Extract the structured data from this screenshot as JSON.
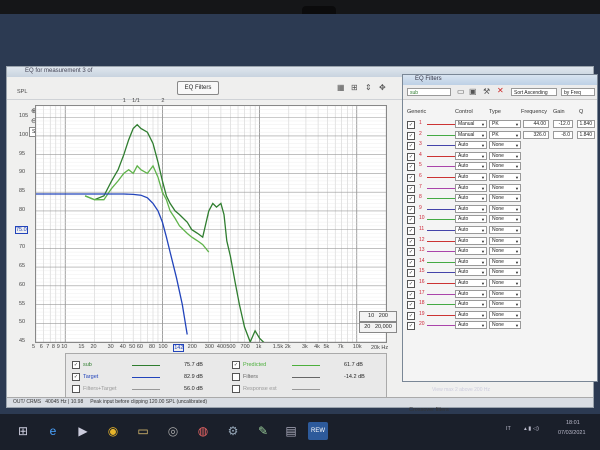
{
  "main_window": {
    "title": "EQ for measurement 3 of",
    "eq_filters_button": "EQ Filters",
    "spl_label": "SPL",
    "spl_dropdown": "SPL",
    "y_ticks": [
      "105",
      "100",
      "95",
      "90",
      "85",
      "80",
      "75.0",
      "70",
      "65",
      "60",
      "55",
      "50",
      "45"
    ],
    "x_ticks": [
      "5",
      "6",
      "7",
      "8",
      "9",
      "10",
      "15",
      "20",
      "30",
      "40",
      "50",
      "60",
      "80",
      "100",
      "142",
      "200",
      "300",
      "400",
      "500",
      "700",
      "1k",
      "1.5k",
      "2k",
      "3k",
      "4k",
      "5k",
      "7k",
      "10k"
    ],
    "top_ticks": [
      "1",
      "1/1",
      "2"
    ],
    "range_boxes": [
      {
        "a": "10",
        "b": "200"
      },
      {
        "a": "20",
        "b": "20,000"
      }
    ],
    "freq_unit": "20k Hz",
    "legend": [
      {
        "checked": true,
        "name": "sub",
        "value": "75.7 dB",
        "color": "#2f7d2f"
      },
      {
        "checked": true,
        "name": "Target",
        "value": "82.9 dB",
        "color": "#2244bb"
      },
      {
        "checked": false,
        "name": "Filters+Target",
        "value": "56.0 dB",
        "color": "#999999"
      },
      {
        "checked": true,
        "name": "Predicted",
        "value": "61.7 dB",
        "color": "#4caf3c"
      },
      {
        "checked": false,
        "name": "Filters",
        "value": "-14.2 dB",
        "color": "#666666"
      },
      {
        "checked": false,
        "name": "Response est",
        "value": "",
        "color": "#999999"
      }
    ],
    "status": {
      "left": "OUT/ CRMS",
      "middle": "40045 Hz | 10.98",
      "right": "Peak input before clipping 120.00 SPL (uncalibrated)"
    }
  },
  "chart_data": {
    "type": "line",
    "xlabel": "",
    "ylabel": "SPL",
    "xscale": "log",
    "xlim": [
      5,
      20000
    ],
    "ylim": [
      45,
      108
    ],
    "grid": true,
    "series": [
      {
        "name": "sub",
        "color": "#2f7d2f",
        "x": [
          16,
          20,
          25,
          30,
          35,
          40,
          45,
          50,
          55,
          60,
          70,
          80,
          90,
          100,
          110,
          120,
          135,
          150,
          180,
          200,
          230,
          260,
          300,
          330,
          360,
          400,
          430,
          460,
          500,
          560,
          620,
          700,
          800,
          900,
          1000,
          1200
        ],
        "y": [
          84,
          83,
          84,
          88,
          91,
          95,
          99,
          102,
          103,
          102,
          101,
          98,
          93,
          88,
          84,
          82,
          80,
          79,
          77,
          75,
          74,
          73,
          80,
          82,
          81,
          82,
          79,
          72,
          68,
          61,
          55,
          49,
          45,
          48,
          46,
          44
        ]
      },
      {
        "name": "Predicted",
        "color": "#5fb34a",
        "x": [
          16,
          20,
          25,
          30,
          35,
          40,
          45,
          50,
          55,
          60,
          70,
          80,
          90,
          100,
          110,
          120,
          135,
          150,
          180,
          200,
          230,
          260,
          300
        ],
        "y": [
          84,
          83,
          83,
          86,
          88,
          90,
          91,
          90,
          92,
          91,
          90,
          92,
          89,
          85,
          83,
          80,
          78,
          76,
          74,
          73,
          72,
          71,
          69
        ]
      },
      {
        "name": "Target",
        "color": "#2244bb",
        "x": [
          5,
          10,
          20,
          30,
          40,
          50,
          60,
          70,
          80,
          90,
          100,
          110,
          120,
          140,
          160,
          180
        ],
        "y": [
          84.5,
          84.5,
          84.5,
          84.5,
          84.5,
          84.4,
          84.2,
          83.5,
          82,
          80,
          77,
          73,
          69,
          62,
          55,
          47
        ]
      }
    ]
  },
  "filters_window": {
    "title": "EQ Filters",
    "measurement": "sub",
    "sort": "Sort Ascending",
    "by": "by Freq",
    "headers": [
      "Generic",
      "Control",
      "Type",
      "Frequency",
      "Gain",
      "Q"
    ],
    "rows": [
      {
        "n": "1",
        "color": "#c33",
        "control": "Manual",
        "type": "PK",
        "freq": "44.00",
        "gain": "-12.0",
        "q": "1.840"
      },
      {
        "n": "2",
        "color": "#4a4",
        "control": "Manual",
        "type": "PK",
        "freq": "326.0",
        "gain": "-8.0",
        "q": "1.840"
      },
      {
        "n": "3",
        "color": "#44a",
        "control": "Auto",
        "type": "None",
        "freq": "",
        "gain": "",
        "q": ""
      },
      {
        "n": "4",
        "color": "#c33",
        "control": "Auto",
        "type": "None",
        "freq": "",
        "gain": "",
        "q": ""
      },
      {
        "n": "5",
        "color": "#a4a",
        "control": "Auto",
        "type": "None",
        "freq": "",
        "gain": "",
        "q": ""
      },
      {
        "n": "6",
        "color": "#c33",
        "control": "Auto",
        "type": "None",
        "freq": "",
        "gain": "",
        "q": ""
      },
      {
        "n": "7",
        "color": "#a4a",
        "control": "Auto",
        "type": "None",
        "freq": "",
        "gain": "",
        "q": ""
      },
      {
        "n": "8",
        "color": "#4a4",
        "control": "Auto",
        "type": "None",
        "freq": "",
        "gain": "",
        "q": ""
      },
      {
        "n": "9",
        "color": "#44a",
        "control": "Auto",
        "type": "None",
        "freq": "",
        "gain": "",
        "q": ""
      },
      {
        "n": "10",
        "color": "#4a4",
        "control": "Auto",
        "type": "None",
        "freq": "",
        "gain": "",
        "q": ""
      },
      {
        "n": "11",
        "color": "#44a",
        "control": "Auto",
        "type": "None",
        "freq": "",
        "gain": "",
        "q": ""
      },
      {
        "n": "12",
        "color": "#c33",
        "control": "Auto",
        "type": "None",
        "freq": "",
        "gain": "",
        "q": ""
      },
      {
        "n": "13",
        "color": "#a4a",
        "control": "Auto",
        "type": "None",
        "freq": "",
        "gain": "",
        "q": ""
      },
      {
        "n": "14",
        "color": "#4a4",
        "control": "Auto",
        "type": "None",
        "freq": "",
        "gain": "",
        "q": ""
      },
      {
        "n": "15",
        "color": "#44a",
        "control": "Auto",
        "type": "None",
        "freq": "",
        "gain": "",
        "q": ""
      },
      {
        "n": "16",
        "color": "#c33",
        "control": "Auto",
        "type": "None",
        "freq": "",
        "gain": "",
        "q": ""
      },
      {
        "n": "17",
        "color": "#a4a",
        "control": "Auto",
        "type": "None",
        "freq": "",
        "gain": "",
        "q": ""
      },
      {
        "n": "18",
        "color": "#4a4",
        "control": "Auto",
        "type": "None",
        "freq": "",
        "gain": "",
        "q": ""
      },
      {
        "n": "19",
        "color": "#c33",
        "control": "Auto",
        "type": "None",
        "freq": "",
        "gain": "",
        "q": ""
      },
      {
        "n": "20",
        "color": "#a4a",
        "control": "Auto",
        "type": "None",
        "freq": "",
        "gain": "",
        "q": ""
      }
    ],
    "crossover_label": "Crossover filters",
    "crossover_rows": [
      {
        "n": "1",
        "control": "BU2",
        "type": "LP",
        "freq": "80.00"
      },
      {
        "n": "2",
        "control": "None",
        "type": "",
        "freq": ""
      }
    ],
    "bottom_note": "View max 2 above 200 Hz"
  },
  "taskbar": {
    "language": "IT",
    "time": "18:01",
    "date": "07/03/2021",
    "rew_label": "REW"
  }
}
